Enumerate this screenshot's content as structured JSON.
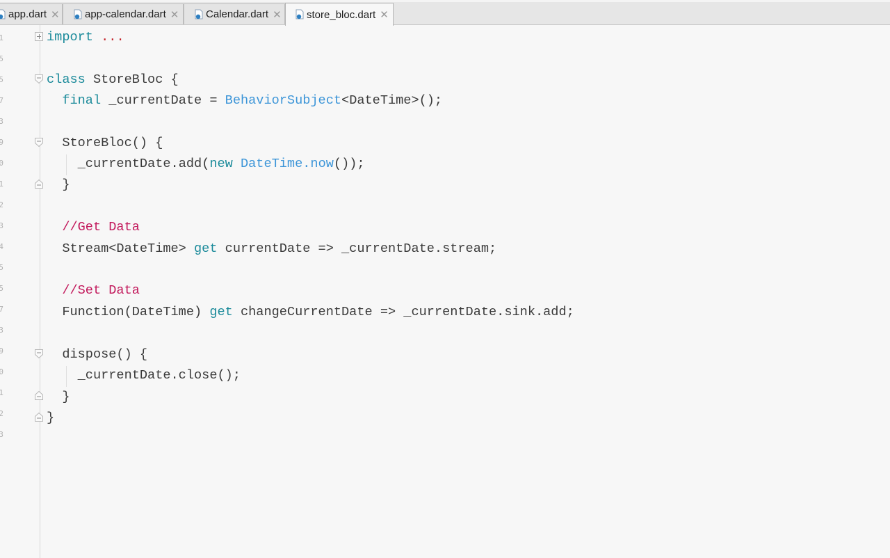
{
  "tabs": [
    {
      "label": "app.dart",
      "active": false
    },
    {
      "label": "app-calendar.dart",
      "active": false
    },
    {
      "label": "Calendar.dart",
      "active": false
    },
    {
      "label": "store_bloc.dart",
      "active": true
    }
  ],
  "close_glyph": "✕",
  "gutter": {
    "line_numbers": [
      "1",
      "5",
      "5",
      "7",
      "3",
      "9",
      "0",
      "1",
      "2",
      "3",
      "4",
      "5",
      "5",
      "7",
      "3",
      "9",
      "0",
      "1",
      "2",
      "3"
    ]
  },
  "editor": {
    "colors": {
      "keyword": "#1a8a9a",
      "type": "#3c95d8",
      "comment": "#c2185b",
      "text": "#3a3a3a",
      "ellipsis": "#c4232a"
    },
    "lines": {
      "l1": {
        "kw": "import",
        "sp": " ",
        "dots": "..."
      },
      "l3": {
        "kw": "class",
        "rest": " StoreBloc {"
      },
      "l4": {
        "indent": "  ",
        "kw": "final",
        "mid": " _currentDate = ",
        "type": "BehaviorSubject",
        "rest": "<DateTime>();"
      },
      "l6": {
        "text": "  StoreBloc() {"
      },
      "l7": {
        "indent": "    ",
        "pre": "_currentDate.add(",
        "kw": "new",
        "sp": " ",
        "type": "DateTime",
        "dot": ".",
        "type2": "now",
        "rest": "());"
      },
      "l8": {
        "text": "  }"
      },
      "l10": {
        "text": "  //Get Data"
      },
      "l11": {
        "pre": "  Stream<DateTime> ",
        "kw": "get",
        "rest": " currentDate => _currentDate.stream;"
      },
      "l13": {
        "text": "  //Set Data"
      },
      "l14": {
        "pre": "  Function(DateTime) ",
        "kw": "get",
        "rest": " changeCurrentDate => _currentDate.sink.add;"
      },
      "l16": {
        "text": "  dispose() {"
      },
      "l17": {
        "text": "    _currentDate.close();"
      },
      "l18": {
        "text": "  }"
      },
      "l19": {
        "text": "}"
      }
    }
  }
}
